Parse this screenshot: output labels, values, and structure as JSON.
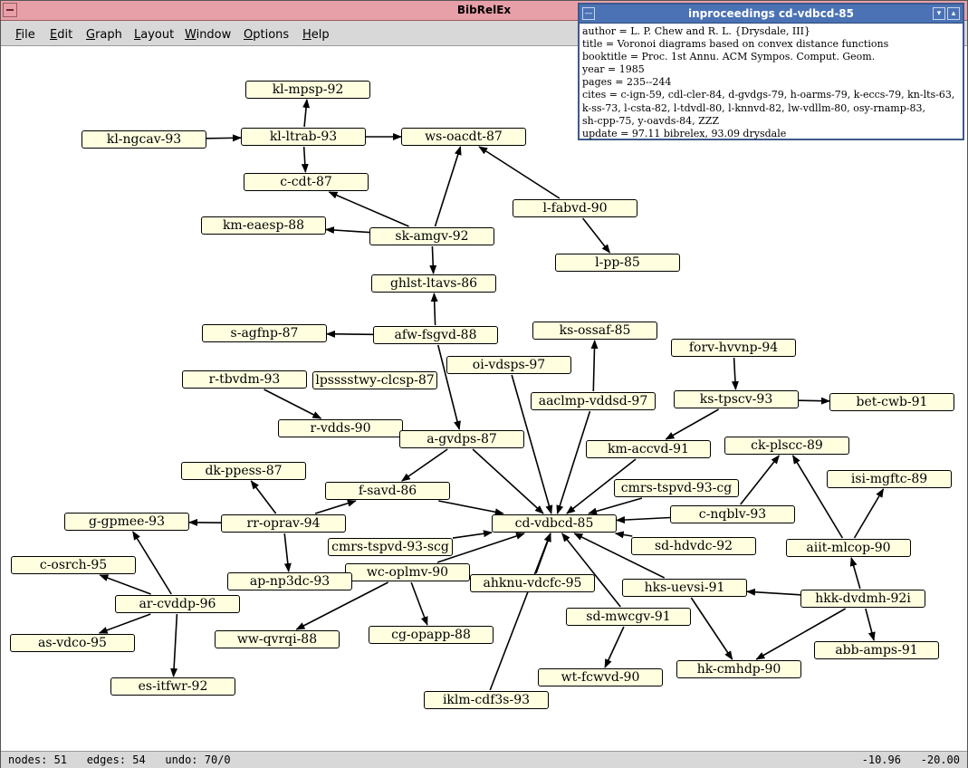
{
  "app": {
    "title": "BibRelEx"
  },
  "menu": [
    {
      "key": "F",
      "rest": "ile"
    },
    {
      "key": "E",
      "rest": "dit"
    },
    {
      "key": "G",
      "rest": "raph"
    },
    {
      "key": "L",
      "rest": "ayout"
    },
    {
      "key": "W",
      "rest": "indow"
    },
    {
      "key": "O",
      "rest": "ptions"
    },
    {
      "key": "H",
      "rest": "elp"
    }
  ],
  "info_window": {
    "title": "inproceedings cd-vdbcd-85",
    "lines": [
      "author = L. P. Chew and R. L. {Drysdale, III}",
      "title = Voronoi diagrams based on convex distance functions",
      "booktitle = Proc. 1st Annu. ACM Sympos. Comput. Geom.",
      "year = 1985",
      "pages = 235--244",
      "cites = c-ign-59, cdl-cler-84, d-gvdgs-79, h-oarms-79, k-eccs-79, kn-lts-63,",
      "k-ss-73,  l-csta-82,  l-tdvdl-80,  l-knnvd-82,  lw-vdllm-80,  osy-rnamp-83,",
      "sh-cpp-75, y-oavds-84, ZZZ",
      "update = 97.11 bibrelex, 93.09 drysdale"
    ]
  },
  "graph": {
    "nodes": [
      "kl-mpsp-92",
      "kl-ngcav-93",
      "kl-ltrab-93",
      "ws-oacdt-87",
      "c-cdt-87",
      "l-fabvd-90",
      "km-eaesp-88",
      "sk-amgv-92",
      "l-pp-85",
      "ghlst-ltavs-86",
      "s-agfnp-87",
      "afw-fsgvd-88",
      "ks-ossaf-85",
      "forv-hvvnp-94",
      "oi-vdsps-97",
      "r-tbvdm-93",
      "lpsssstwy-clcsp-87",
      "aaclmp-vddsd-97",
      "ks-tpscv-93",
      "bet-cwb-91",
      "r-vdds-90",
      "a-gvdps-87",
      "km-accvd-91",
      "ck-plscc-89",
      "dk-ppess-87",
      "f-savd-86",
      "cmrs-tspvd-93-cg",
      "isi-mgftc-89",
      "g-gpmee-93",
      "rr-oprav-94",
      "cd-vdbcd-85",
      "c-nqblv-93",
      "cmrs-tspvd-93-scg",
      "sd-hdvdc-92",
      "aiit-mlcop-90",
      "c-osrch-95",
      "wc-oplmv-90",
      "ap-np3dc-93",
      "ahknu-vdcfc-95",
      "hks-uevsi-91",
      "ar-cvddp-96",
      "hkk-dvdmh-92i",
      "sd-mwcgv-91",
      "as-vdco-95",
      "ww-qvrqi-88",
      "cg-opapp-88",
      "abb-amps-91",
      "hk-cmhdp-90",
      "wt-fcwvd-90",
      "es-itfwr-92",
      "iklm-cdf3s-93"
    ]
  },
  "status": {
    "left": "nodes: 51   edges: 54   undo: 70/0",
    "right": "-10.96   -20.00"
  }
}
